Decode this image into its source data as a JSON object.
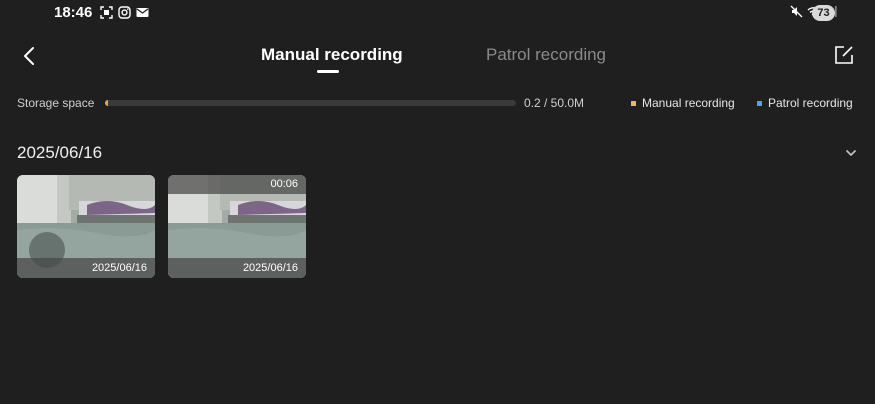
{
  "status_bar": {
    "time": "18:46",
    "battery": "73"
  },
  "header": {
    "tabs": [
      {
        "label": "Manual recording",
        "active": true
      },
      {
        "label": "Patrol recording",
        "active": false
      }
    ]
  },
  "storage": {
    "label": "Storage space",
    "value_text": "0.2 / 50.0M",
    "used_fraction": 0.004,
    "legend": [
      {
        "label": "Manual recording",
        "color": "#f2b45a"
      },
      {
        "label": "Patrol recording",
        "color": "#4fa3e8"
      }
    ]
  },
  "recordings": {
    "groups": [
      {
        "date": "2025/06/16",
        "items": [
          {
            "caption": "2025/06/16",
            "duration": ""
          },
          {
            "caption": "2025/06/16",
            "duration": "00:06"
          }
        ]
      }
    ]
  },
  "colors": {
    "background": "#1f1f1f",
    "active_tab": "#ffffff",
    "inactive_tab": "#8a8a8a",
    "storage_fill": "#f2a33a"
  }
}
